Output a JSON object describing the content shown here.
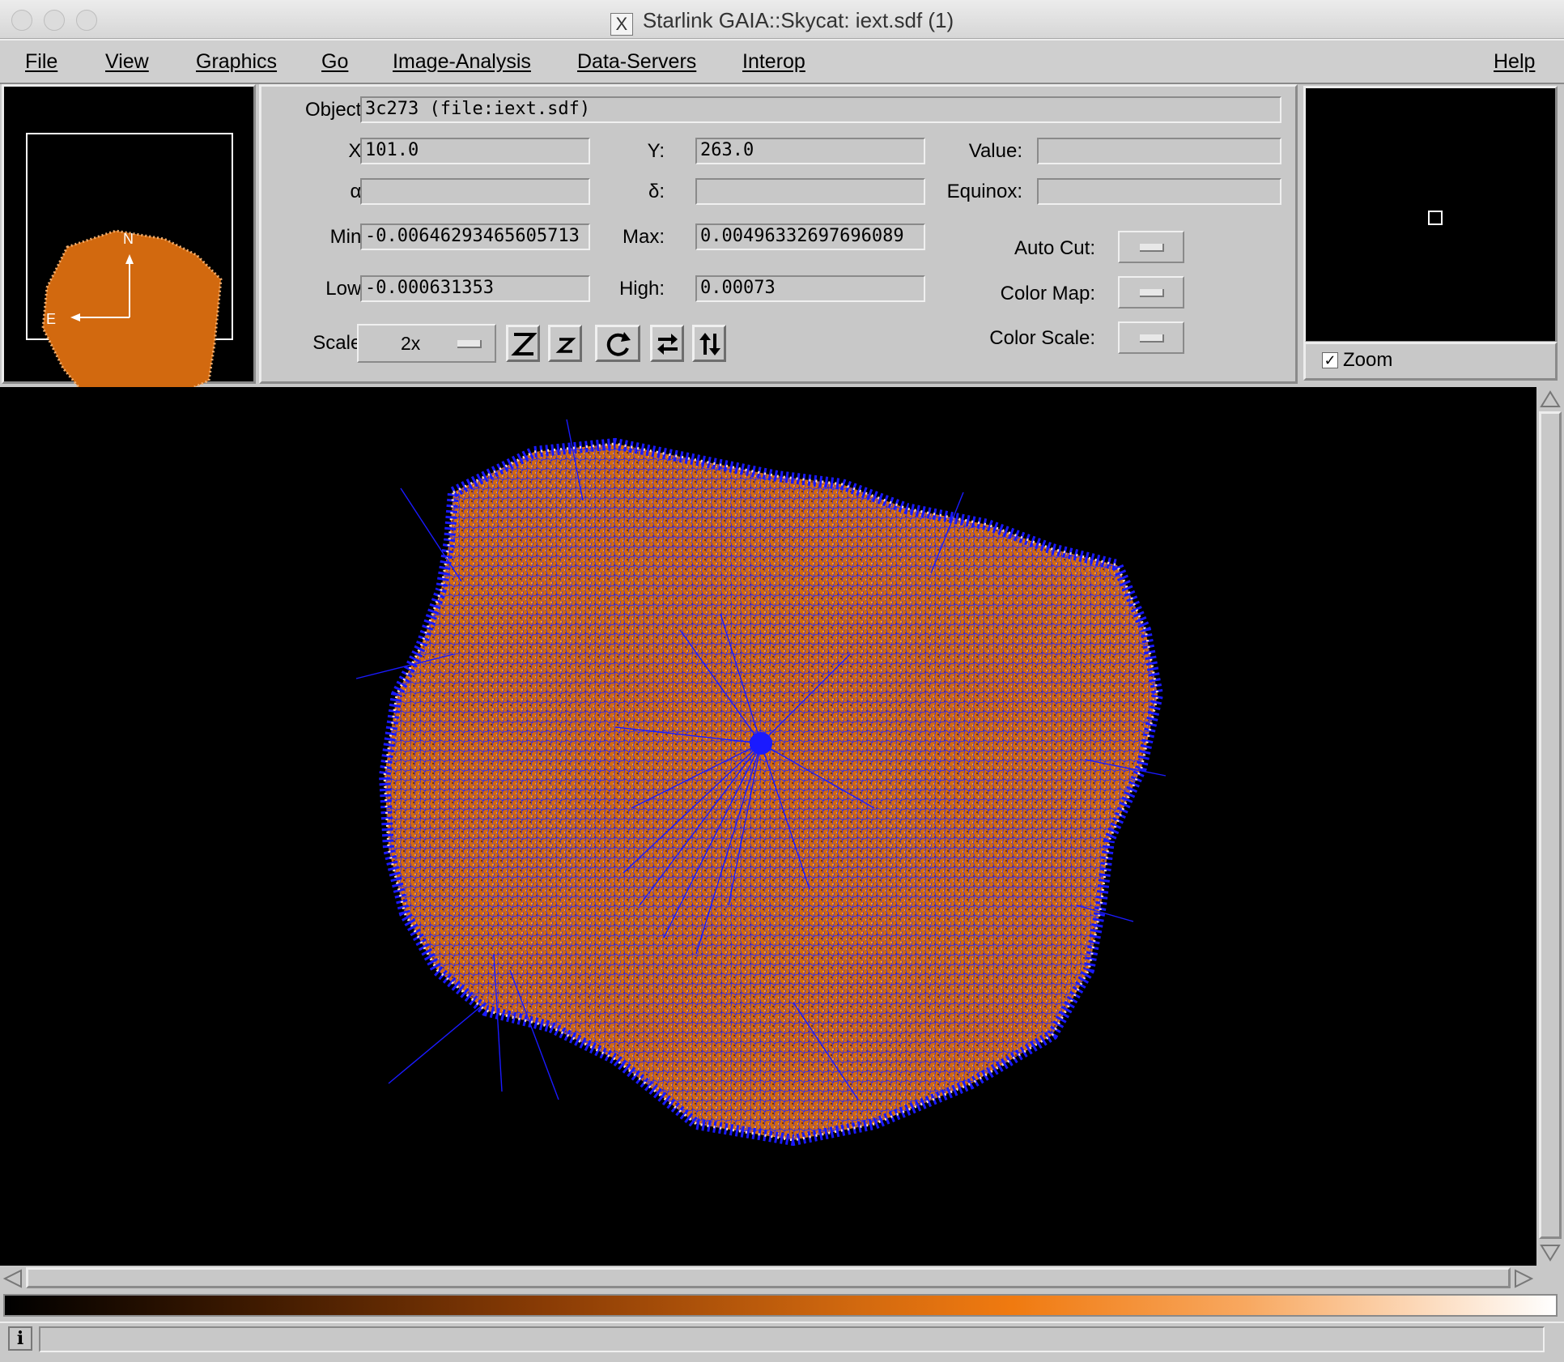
{
  "window": {
    "title": "Starlink GAIA::Skycat: iext.sdf (1)"
  },
  "menu": {
    "items": [
      "File",
      "View",
      "Graphics",
      "Go",
      "Image-Analysis",
      "Data-Servers",
      "Interop"
    ],
    "help": "Help"
  },
  "panner": {
    "compass_north": "N",
    "compass_east": "E"
  },
  "info": {
    "object_label": "Object:",
    "object_value": "3c273 (file:iext.sdf)",
    "x_label": "X:",
    "x_value": "101.0",
    "y_label": "Y:",
    "y_value": "263.0",
    "value_label": "Value:",
    "value_value": "",
    "ra_label": "α:",
    "ra_value": "",
    "dec_label": "δ:",
    "dec_value": "",
    "equinox_label": "Equinox:",
    "equinox_value": "",
    "min_label": "Min:",
    "min_value": "-0.00646293465605713",
    "max_label": "Max:",
    "max_value": "0.00496332697696089",
    "low_label": "Low:",
    "low_value": "-0.000631353",
    "high_label": "High:",
    "high_value": "0.00073",
    "autocut_label": "Auto Cut:",
    "colormap_label": "Color Map:",
    "colorscale_label": "Color Scale:",
    "scale_label": "Scale:",
    "scale_value": "2x",
    "toolbar": [
      "zoom-in-icon",
      "zoom-out-icon",
      "rotate-icon",
      "flip-x-icon",
      "flip-y-icon"
    ]
  },
  "magnifier": {
    "zoom_label": "Zoom",
    "zoom_checked": true
  },
  "colors": {
    "image_orange": "#d2690f",
    "overlay_blue": "#1a1aff",
    "background": "#c8c8c8"
  }
}
